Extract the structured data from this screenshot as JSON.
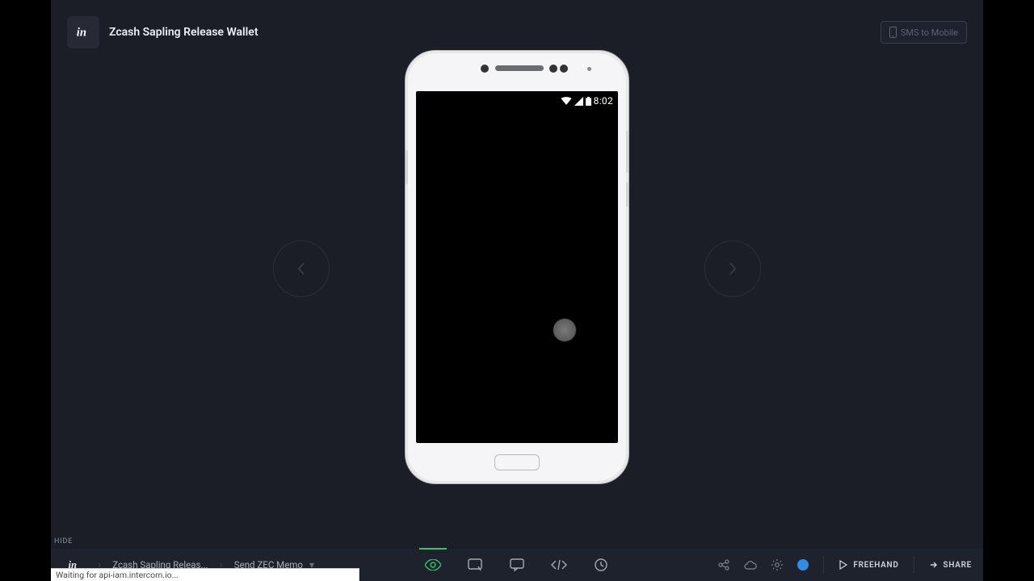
{
  "logo_text": "in",
  "project_title": "Zcash Sapling Release Wallet",
  "sms_button_label": "SMS to Mobile",
  "status_bar": {
    "time": "8:02"
  },
  "hide_label": "HIDE",
  "breadcrumbs": {
    "project_short": "Zcash Sapling Releas...",
    "screen_name": "Send ZEC Memo"
  },
  "footer": {
    "freehand_label": "FREEHAND",
    "share_label": "SHARE"
  },
  "browser_status": "Waiting for api-iam.intercom.io..."
}
